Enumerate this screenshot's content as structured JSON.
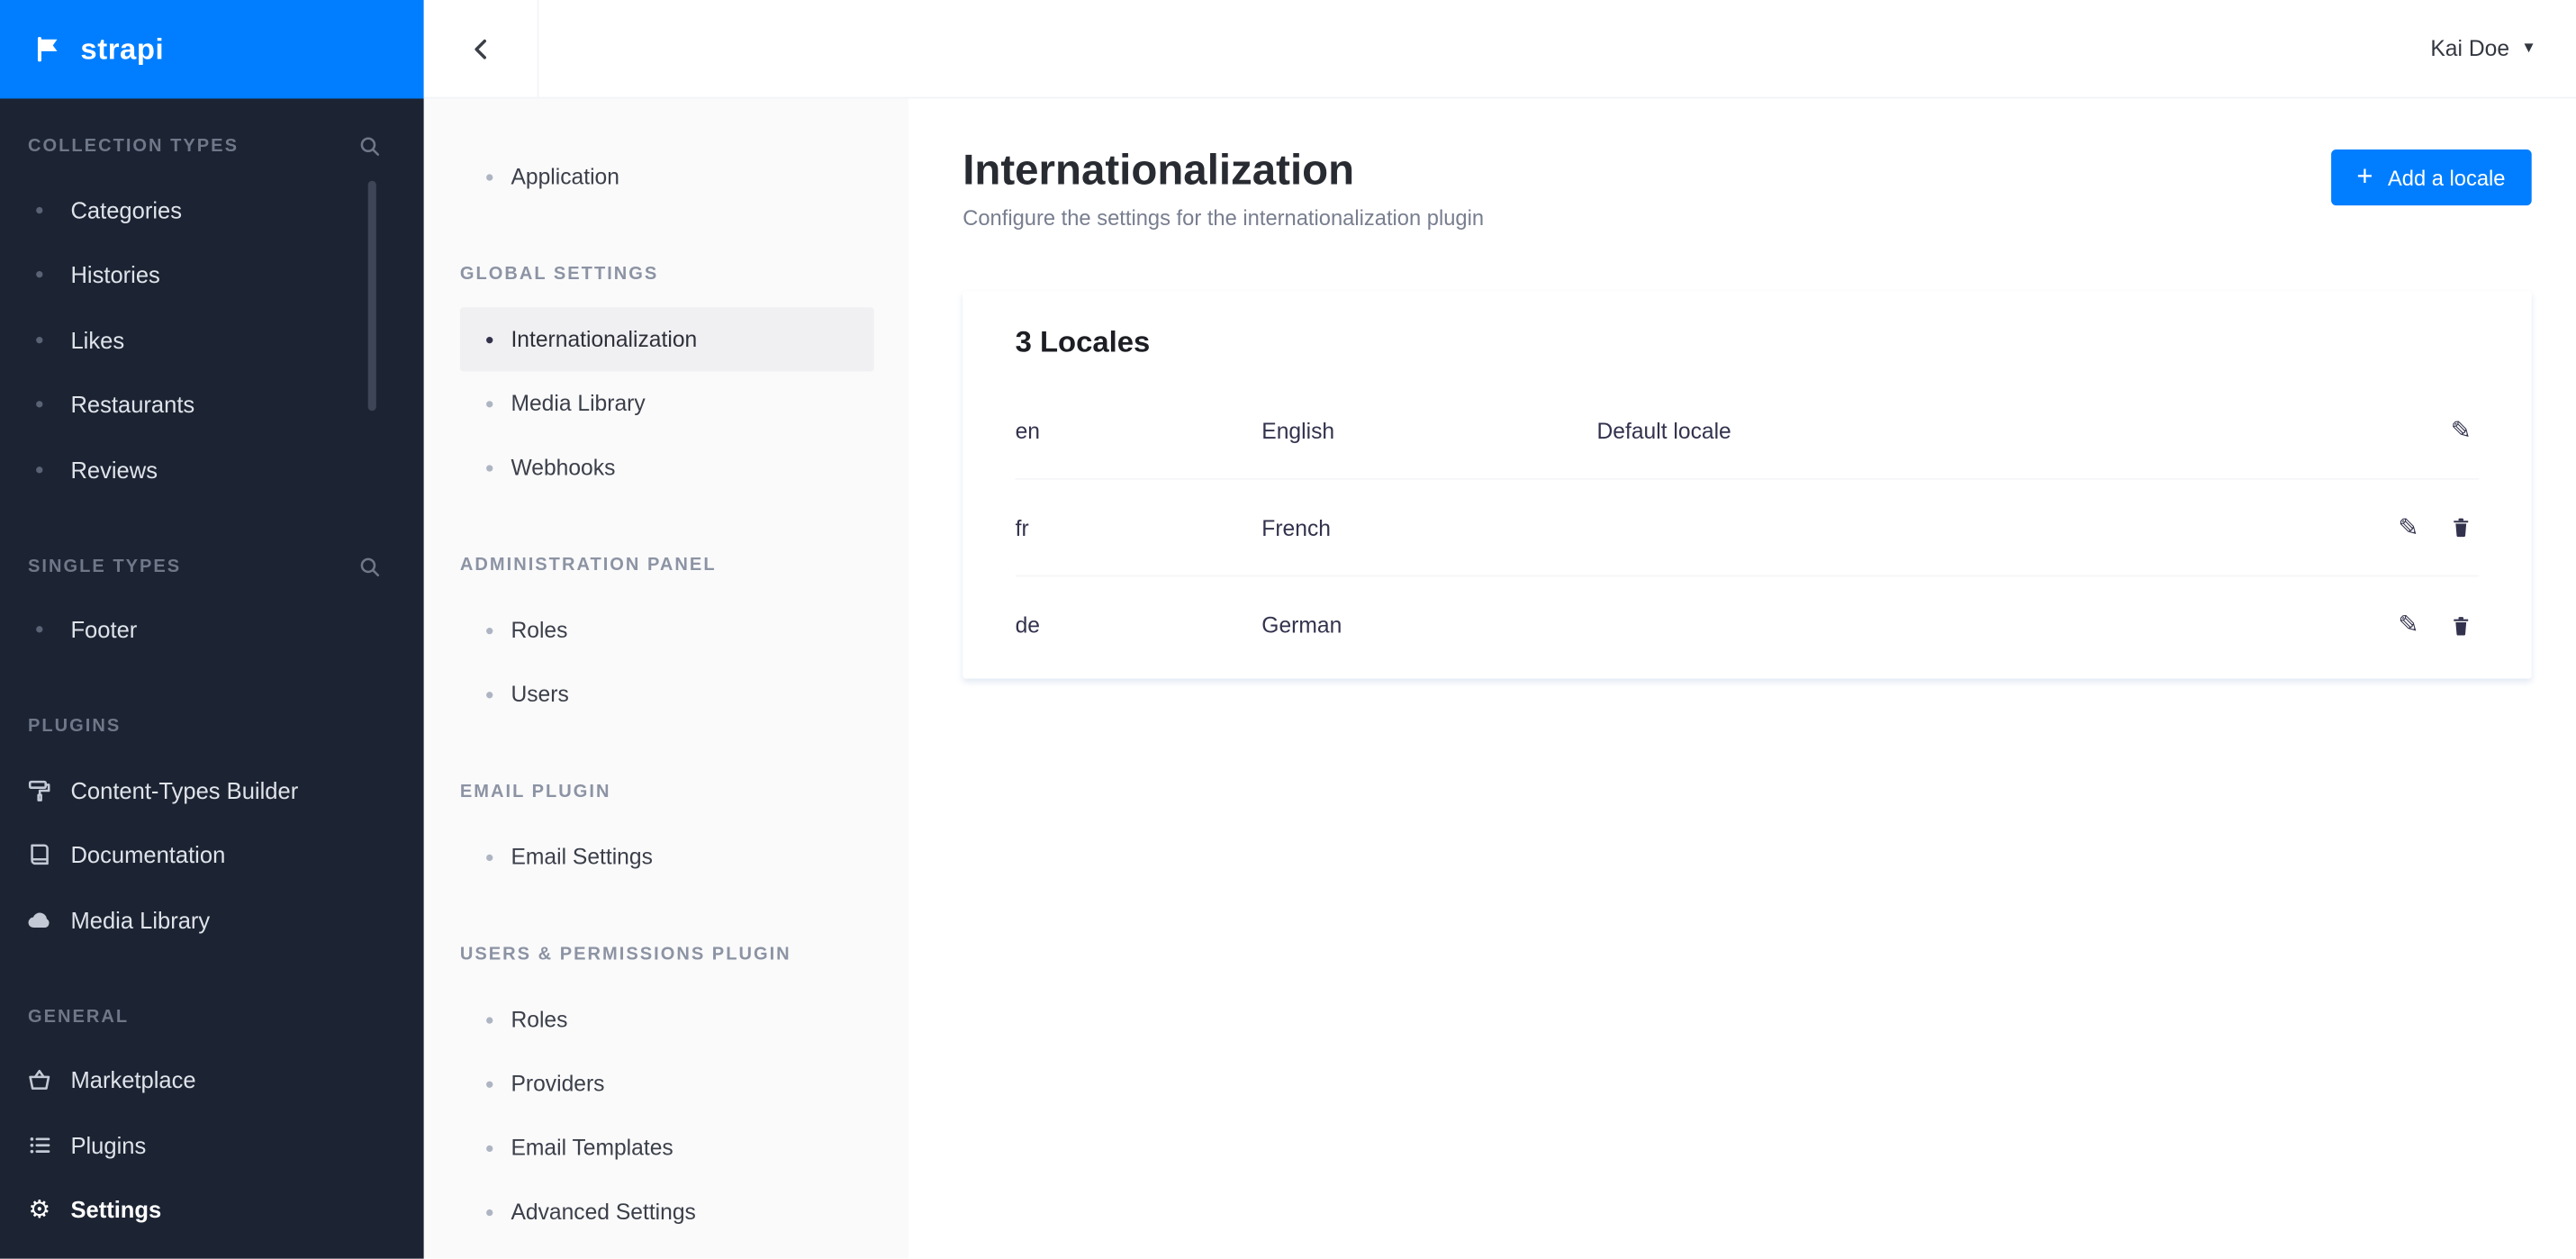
{
  "logo": {
    "text": "strapi"
  },
  "topbar": {
    "user_name": "Kai Doe"
  },
  "primary_nav": {
    "sections": [
      {
        "title": "COLLECTION TYPES",
        "items": [
          "Categories",
          "Histories",
          "Likes",
          "Restaurants",
          "Reviews"
        ]
      },
      {
        "title": "SINGLE TYPES",
        "items": [
          "Footer"
        ]
      },
      {
        "title": "PLUGINS",
        "items": [
          "Content-Types Builder",
          "Documentation",
          "Media Library"
        ]
      },
      {
        "title": "GENERAL",
        "items": [
          "Marketplace",
          "Plugins",
          "Settings"
        ]
      }
    ],
    "active_item": "Settings"
  },
  "settings_nav": {
    "top_items": [
      "Application"
    ],
    "sections": [
      {
        "title": "GLOBAL SETTINGS",
        "items": [
          "Internationalization",
          "Media Library",
          "Webhooks"
        ]
      },
      {
        "title": "ADMINISTRATION PANEL",
        "items": [
          "Roles",
          "Users"
        ]
      },
      {
        "title": "EMAIL PLUGIN",
        "items": [
          "Email Settings"
        ]
      },
      {
        "title": "USERS & PERMISSIONS PLUGIN",
        "items": [
          "Roles",
          "Providers",
          "Email Templates",
          "Advanced Settings"
        ]
      }
    ],
    "active_item": "Internationalization"
  },
  "page": {
    "title": "Internationalization",
    "subtitle": "Configure the settings for the internationalization plugin",
    "add_button_label": "Add a locale"
  },
  "locales": {
    "card_title": "3 Locales",
    "rows": [
      {
        "code": "en",
        "name": "English",
        "note": "Default locale",
        "actions": [
          "edit"
        ]
      },
      {
        "code": "fr",
        "name": "French",
        "note": "",
        "actions": [
          "edit",
          "delete"
        ]
      },
      {
        "code": "de",
        "name": "German",
        "note": "",
        "actions": [
          "edit",
          "delete"
        ]
      }
    ]
  },
  "icons": {
    "plus": "+",
    "caret_down": "▾",
    "pencil": "✎",
    "gear": "⚙"
  },
  "colors": {
    "accent": "#007EFF",
    "sidebar_bg": "#1c2332",
    "subnav_bg": "#fafafb"
  }
}
